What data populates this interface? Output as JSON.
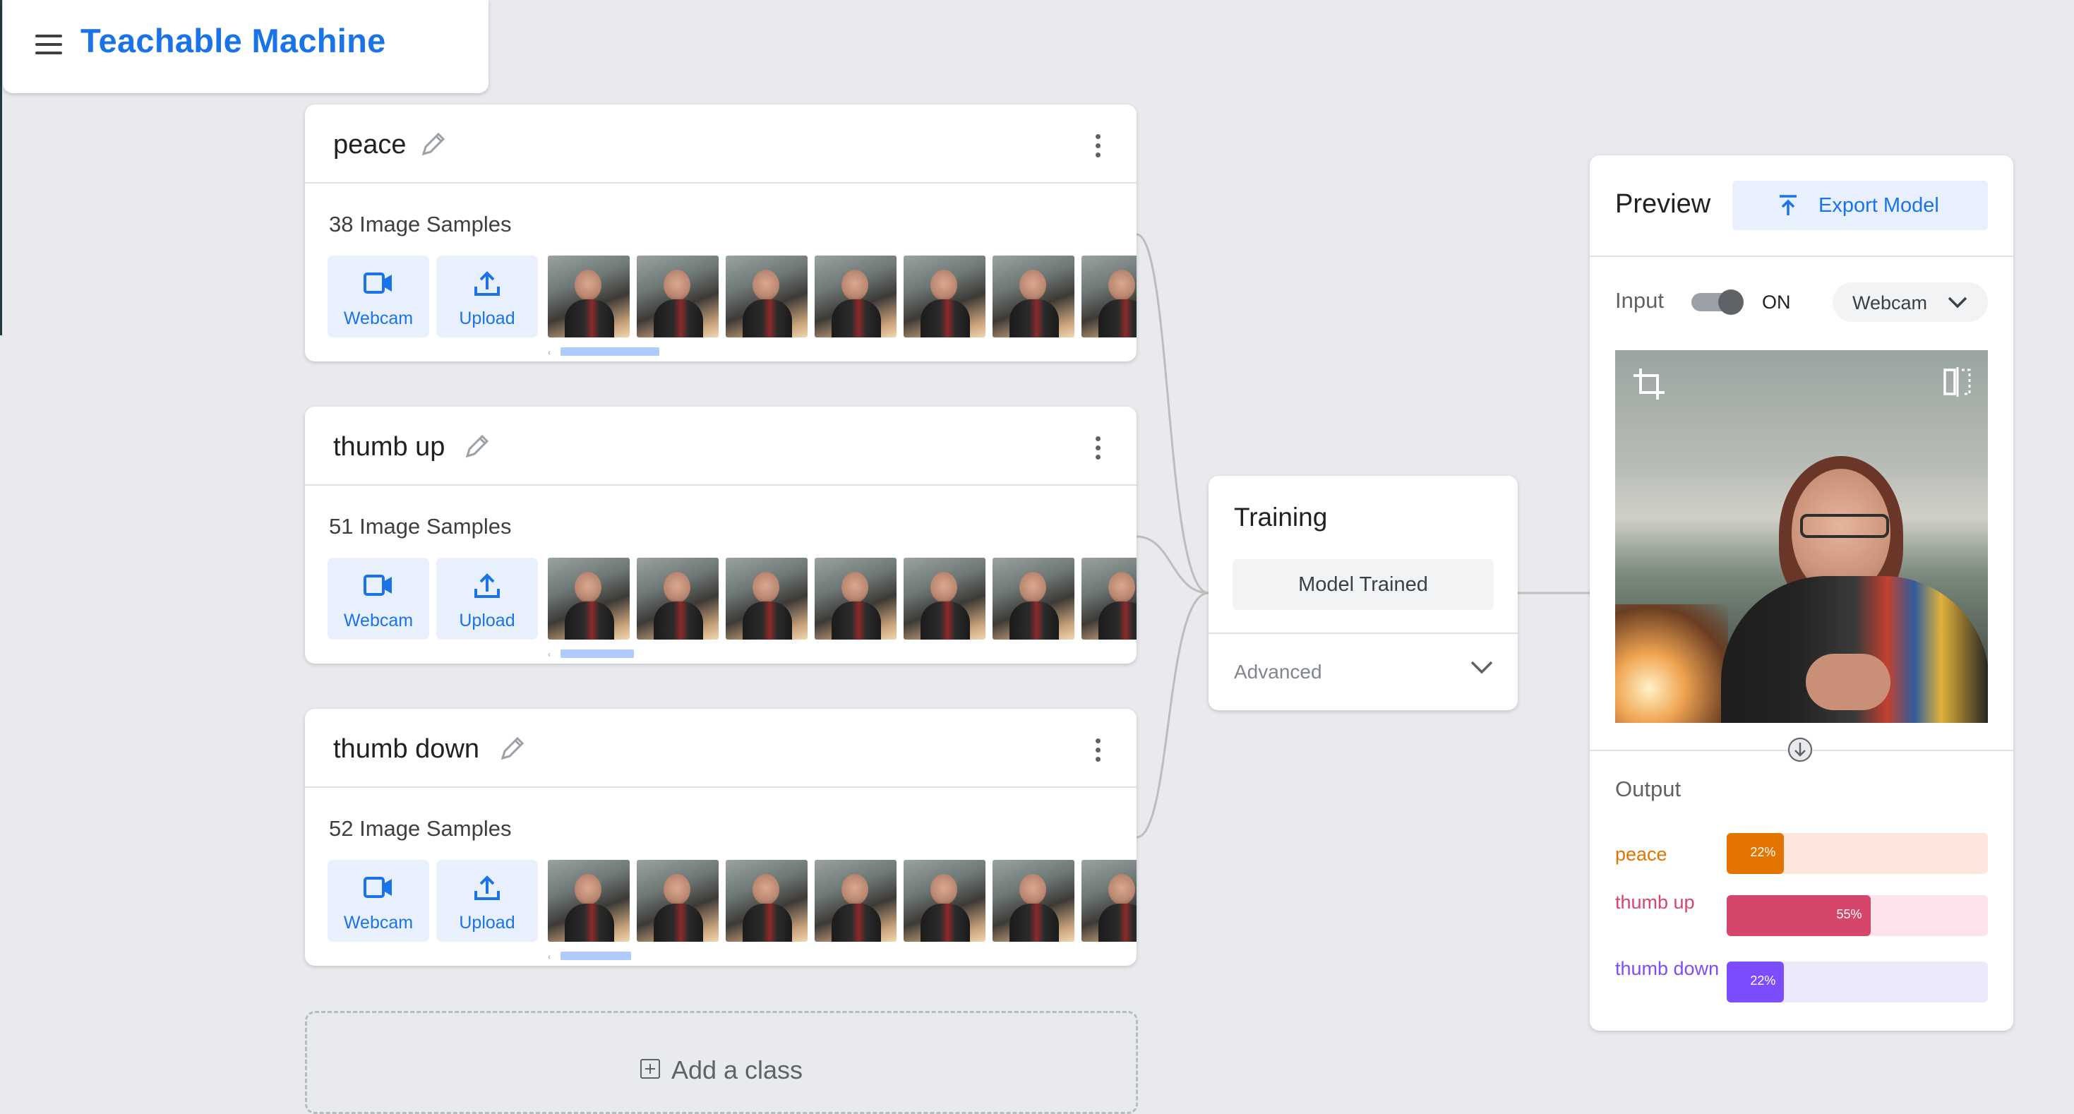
{
  "app": {
    "title": "Teachable Machine"
  },
  "classes": [
    {
      "name": "peace",
      "count_label": "38 Image Samples"
    },
    {
      "name": "thumb up",
      "count_label": "51 Image Samples"
    },
    {
      "name": "thumb down",
      "count_label": "52 Image Samples"
    }
  ],
  "sample_sources": {
    "webcam": "Webcam",
    "upload": "Upload"
  },
  "add_class": "Add a class",
  "training": {
    "title": "Training",
    "button": "Model Trained",
    "advanced": "Advanced"
  },
  "preview": {
    "title": "Preview",
    "export": "Export Model",
    "input_label": "Input",
    "toggle_state": "ON",
    "source": "Webcam",
    "output_label": "Output",
    "outputs": [
      {
        "name": "peace",
        "percent": 22,
        "percent_label": "22%",
        "color": "#e37400",
        "track": "#fde7dc"
      },
      {
        "name": "thumb up",
        "percent": 55,
        "percent_label": "55%",
        "color": "#d6466b",
        "track": "#fce4ea"
      },
      {
        "name": "thumb down",
        "percent": 22,
        "percent_label": "22%",
        "color": "#7c4dff",
        "track": "#ece9fb"
      }
    ]
  }
}
